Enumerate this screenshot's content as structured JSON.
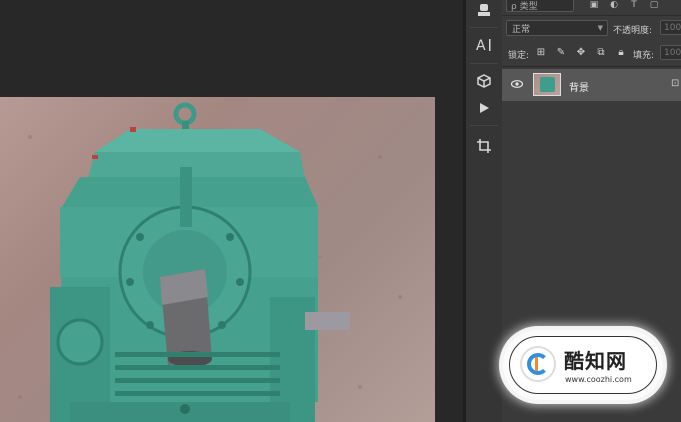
{
  "layers_panel": {
    "filter_label": "ρ 类型",
    "blend_mode": "正常",
    "opacity_label": "不透明度:",
    "opacity_value": "100",
    "lock_label": "锁定:",
    "fill_label": "填充:",
    "fill_value": "100",
    "layer": {
      "name": "背景",
      "visible": true,
      "locked": true
    }
  },
  "watermark": {
    "title": "酷知网",
    "url": "www.coozhi.com"
  },
  "icons": {
    "tools": [
      "stamp-icon",
      "character-text-icon",
      "3d-cube-icon",
      "play-icon",
      "crop-icon"
    ],
    "filter": [
      "pixel-filter-icon",
      "adjustment-filter-icon",
      "type-filter-icon",
      "shape-filter-icon"
    ],
    "lock": [
      "lock-transparent-icon",
      "lock-brush-icon",
      "lock-move-icon",
      "lock-artboard-icon",
      "lock-all-icon"
    ]
  }
}
